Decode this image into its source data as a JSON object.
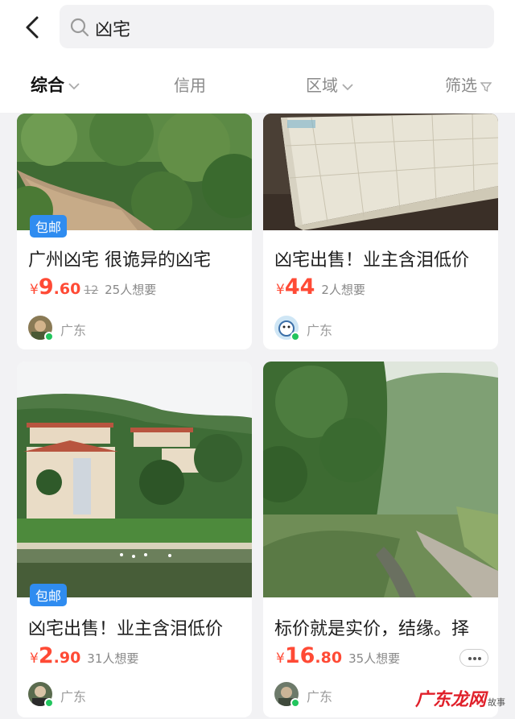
{
  "search": {
    "query": "凶宅"
  },
  "tabs": [
    {
      "label": "综合"
    },
    {
      "label": "信用"
    },
    {
      "label": "区域"
    },
    {
      "label": "筛选"
    }
  ],
  "listings": [
    {
      "badge": "包邮",
      "title": "广州凶宅 很诡异的凶宅",
      "currency": "¥",
      "price_int": "9",
      "price_dec": ".60",
      "orig_price": "12",
      "wants": "25人想要",
      "location": "广东"
    },
    {
      "badge": "",
      "title": "凶宅出售！业主含泪低价",
      "currency": "¥",
      "price_int": "44",
      "price_dec": "",
      "orig_price": "",
      "wants": "2人想要",
      "location": "广东"
    },
    {
      "badge": "包邮",
      "title": "凶宅出售！业主含泪低价",
      "currency": "¥",
      "price_int": "2",
      "price_dec": ".90",
      "orig_price": "",
      "wants": "31人想要",
      "location": "广东"
    },
    {
      "badge": "",
      "title": "标价就是实价，结缘。择",
      "currency": "¥",
      "price_int": "16",
      "price_dec": ".80",
      "orig_price": "",
      "wants": "35人想要",
      "location": "广东"
    }
  ],
  "watermark": {
    "text": "广东龙网",
    "sub": "故事"
  },
  "colors": {
    "accent_price": "#ff4a35",
    "badge_blue": "#2f8cf0",
    "online_dot": "#22c55e"
  },
  "icons": {
    "back": "chevron-left-icon",
    "search": "search-icon",
    "filter": "funnel-icon",
    "more": "more-dots-icon"
  }
}
